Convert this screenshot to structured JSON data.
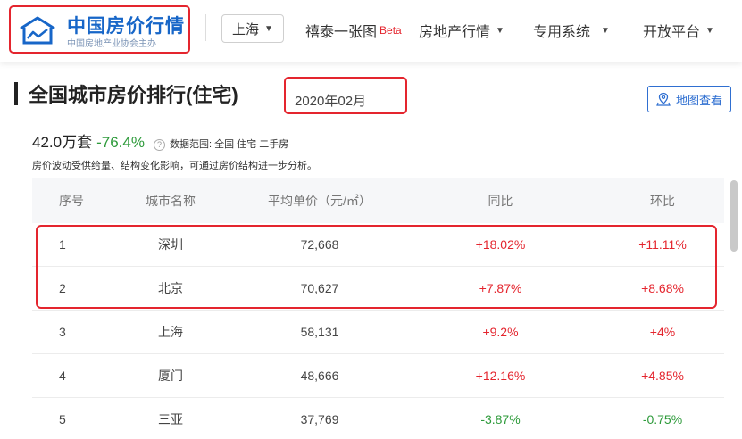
{
  "header": {
    "logo": {
      "title": "中国房价行情",
      "subtitle": "中国房地产业协会主办"
    },
    "city": "上海",
    "nav": [
      {
        "label": "禧泰一张图",
        "badge": "Beta"
      },
      {
        "label": "房地产行情"
      },
      {
        "label": "专用系统"
      },
      {
        "label": "开放平台"
      }
    ]
  },
  "page": {
    "title": "全国城市房价排行(住宅)",
    "date": "2020年02月",
    "map_button": "地图查看",
    "summary": {
      "total": "42.0万套",
      "change": "-76.4%",
      "scope": "数据范围:  全国   住宅   二手房",
      "note": "房价波动受供给量、结构变化影响，可通过房价结构进一步分析。"
    }
  },
  "table": {
    "headers": [
      "序号",
      "城市名称",
      "平均单价（元/㎡）",
      "同比",
      "环比"
    ],
    "rows": [
      [
        "1",
        "深圳",
        "72,668",
        "+18.02%",
        "+11.11%"
      ],
      [
        "2",
        "北京",
        "70,627",
        "+7.87%",
        "+8.68%"
      ],
      [
        "3",
        "上海",
        "58,131",
        "+9.2%",
        "+4%"
      ],
      [
        "4",
        "厦门",
        "48,666",
        "+12.16%",
        "+4.85%"
      ],
      [
        "5",
        "三亚",
        "37,769",
        "-3.87%",
        "-0.75%"
      ]
    ]
  },
  "colors": {
    "accent": "#1766c8",
    "up": "#e4252e",
    "down": "#2d9a3a",
    "annotation": "#e4252e"
  }
}
